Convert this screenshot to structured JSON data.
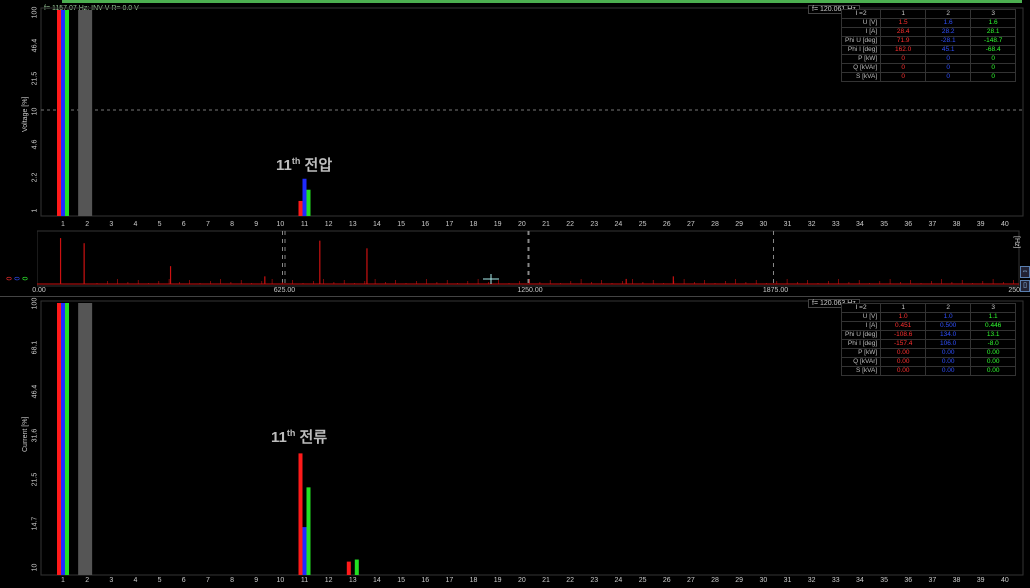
{
  "colors": {
    "red": "#ff1a1a",
    "blue": "#1f2bff",
    "green": "#22e022",
    "grey": "#555555",
    "spectrum": "#cc1111"
  },
  "voltage_panel": {
    "status": "f= 1157.07 Hz: INV V R= 0.0 V",
    "ylabel": "Voltage [%]",
    "yticks": [
      "100",
      "46.4",
      "21.5",
      "10",
      "4.6",
      "2.2",
      "1"
    ],
    "freq": "f= 120.061 Hz",
    "annotation": {
      "num": "11",
      "sup": "th",
      "text": "전압"
    },
    "table": {
      "header": [
        "I =2",
        "1",
        "2",
        "3"
      ],
      "rows": [
        {
          "label": "U [V]",
          "v": [
            "1.5",
            "1.6",
            "1.6"
          ]
        },
        {
          "label": "I [A]",
          "v": [
            "28.4",
            "28.2",
            "28.1"
          ]
        },
        {
          "label": "Phi U [deg]",
          "v": [
            "71.9",
            "-28.1",
            "-148.7"
          ]
        },
        {
          "label": "Phi I [deg]",
          "v": [
            "162.0",
            "45.1",
            "-68.4"
          ]
        },
        {
          "label": "P [kW]",
          "v": [
            "0",
            "0",
            "0"
          ]
        },
        {
          "label": "Q [kVAr]",
          "v": [
            "0",
            "0",
            "0"
          ]
        },
        {
          "label": "S [kVA]",
          "v": [
            "0",
            "0",
            "0"
          ]
        }
      ]
    }
  },
  "spectrum_panel": {
    "xticks": [
      "0.00",
      "625.00",
      "1250.00",
      "1875.00",
      "2500.00"
    ],
    "yticks": [
      "0",
      "0",
      "0"
    ],
    "side_label": "[Hz]"
  },
  "current_panel": {
    "ylabel": "Current [%]",
    "yticks": [
      "100",
      "68.1",
      "46.4",
      "31.6",
      "21.5",
      "14.7",
      "10"
    ],
    "freq": "f= 120.063 Hz",
    "annotation": {
      "num": "11",
      "sup": "th",
      "text": "전류"
    },
    "table": {
      "header": [
        "I =2",
        "1",
        "2",
        "3"
      ],
      "rows": [
        {
          "label": "U [V]",
          "v": [
            "1.0",
            "1.0",
            "1.1"
          ]
        },
        {
          "label": "I [A]",
          "v": [
            "0.451",
            "0.500",
            "0.446"
          ]
        },
        {
          "label": "Phi U [deg]",
          "v": [
            "-108.6",
            "134.0",
            "13.1"
          ]
        },
        {
          "label": "Phi I [deg]",
          "v": [
            "-157.4",
            "106.0",
            "-8.0"
          ]
        },
        {
          "label": "P [kW]",
          "v": [
            "0.00",
            "0.00",
            "0.00"
          ]
        },
        {
          "label": "Q [kVAr]",
          "v": [
            "0.00",
            "0.00",
            "0.00"
          ]
        },
        {
          "label": "S [kVA]",
          "v": [
            "0.00",
            "0.00",
            "0.00"
          ]
        }
      ]
    }
  },
  "harmonic_xticks": [
    "1",
    "2",
    "3",
    "4",
    "5",
    "6",
    "7",
    "8",
    "9",
    "10",
    "11",
    "12",
    "13",
    "14",
    "15",
    "16",
    "17",
    "18",
    "19",
    "20",
    "21",
    "22",
    "23",
    "24",
    "25",
    "26",
    "27",
    "28",
    "29",
    "30",
    "31",
    "32",
    "33",
    "34",
    "35",
    "36",
    "37",
    "38",
    "39",
    "40"
  ],
  "chart_data": [
    {
      "type": "bar",
      "title": "",
      "ylabel": "Voltage [%]",
      "scale": "log",
      "ylim": [
        1,
        100
      ],
      "categories": [
        "1",
        "2",
        "11"
      ],
      "series": [
        {
          "values": [
            100,
            null,
            1.4
          ]
        },
        {
          "values": [
            100,
            null,
            2.3
          ]
        },
        {
          "values": [
            100,
            null,
            1.8
          ]
        }
      ]
    },
    {
      "type": "line",
      "xlim": [
        0,
        2500
      ],
      "xticks": [
        0,
        625,
        1250,
        1875,
        2500
      ],
      "peaks": [
        [
          60,
          0.9
        ],
        [
          120,
          0.8
        ],
        [
          340,
          0.35
        ],
        [
          580,
          0.15
        ],
        [
          720,
          0.85
        ],
        [
          840,
          0.7
        ],
        [
          1500,
          0.1
        ],
        [
          1620,
          0.15
        ]
      ]
    },
    {
      "type": "bar",
      "title": "",
      "ylabel": "Current [%]",
      "scale": "log",
      "ylim": [
        10,
        100
      ],
      "categories": [
        "1",
        "2",
        "11",
        "13"
      ],
      "series": [
        {
          "values": [
            100,
            null,
            28,
            11.2
          ]
        },
        {
          "values": [
            100,
            null,
            15,
            null
          ]
        },
        {
          "values": [
            100,
            null,
            21,
            11.4
          ]
        }
      ]
    }
  ]
}
